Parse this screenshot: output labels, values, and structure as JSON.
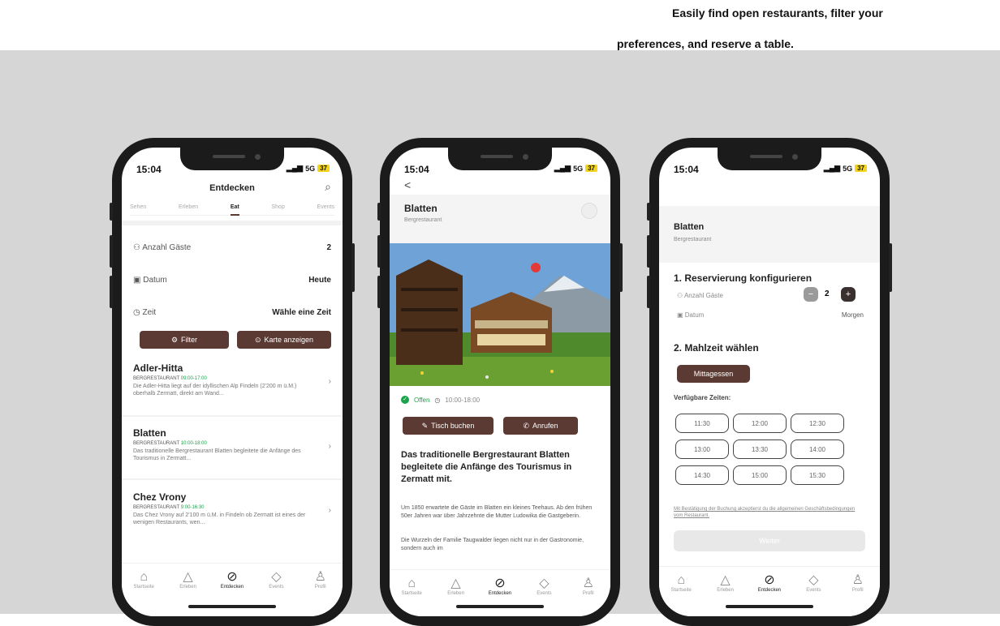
{
  "caption": {
    "line1": "Easily find open restaurants, filter your",
    "line2": "preferences, and reserve a table."
  },
  "status": {
    "time": "15:04",
    "network": "5G",
    "battery": "37"
  },
  "tab_labels": [
    "Startseite",
    "Erleben",
    "Entdecken",
    "Events",
    "Profil"
  ],
  "phone1": {
    "header_title": "Entdecken",
    "top_tabs": [
      "Sehen",
      "Erleben",
      "Eat",
      "Shop",
      "Events"
    ],
    "active_tab": "Eat",
    "guests_label": "Anzahl Gäste",
    "guests_value": "2",
    "date_label": "Datum",
    "date_value": "Heute",
    "time_label": "Zeit",
    "time_value": "Wähle eine Zeit",
    "filter_button": "Filter",
    "map_button": "Karte anzeigen",
    "restaurants": [
      {
        "name": "Adler-Hitta",
        "category": "BERGRESTAURANT",
        "hours": "09:00-17:00",
        "description": "Die Adler-Hitta liegt auf der idyllischen Alp Findeln (2'200 m ü.M.) oberhalb Zermatt, direkt am Wand..."
      },
      {
        "name": "Blatten",
        "category": "BERGRESTAURANT",
        "hours": "10:00-18:00",
        "description": "Das traditionelle Bergrestaurant Blatten begleitete die Anfänge des Tourismus in Zermatt..."
      },
      {
        "name": "Chez Vrony",
        "category": "BERGRESTAURANT",
        "hours": "9:00-16:30",
        "description": "Das Chez Vrony auf 2'100 m ü.M. in Findeln ob Zermatt ist eines der wenigen Restaurants, wen..."
      }
    ]
  },
  "phone2": {
    "back": "<",
    "title": "Blatten",
    "subtitle": "Bergrestaurant",
    "open_label": "Offen",
    "hours": "10:00-18:00",
    "book_button": "Tisch buchen",
    "call_button": "Anrufen",
    "headline": "Das traditionelle Bergrestaurant Blatten begleitete die Anfänge des Tourismus in Zermatt mit.",
    "para1": "Um 1850 erwartete die Gäste im Blatten ein kleines Teehaus. Ab den frühen 50er Jahren war über Jahrzehnte die Mutter Ludowika die Gastgeberin.",
    "para2": "Die Wurzeln der Familie Taugwalder liegen nicht nur in der Gastronomie, sondern auch im"
  },
  "phone3": {
    "title": "Blatten",
    "subtitle": "Bergrestaurant",
    "step1": "1. Reservierung konfigurieren",
    "guests_label": "Anzahl Gäste",
    "guests_value": "2",
    "minus": "−",
    "plus": "+",
    "date_label": "Datum",
    "date_value": "Morgen",
    "step2": "2. Mahlzeit wählen",
    "meal_button": "Mittagessen",
    "available_label": "Verfügbare Zeiten:",
    "slots": [
      "11:30",
      "12:00",
      "12:30",
      "13:00",
      "13:30",
      "14:00",
      "14:30",
      "15:00",
      "15:30"
    ],
    "terms": "Mit Bestätigung der Buchung akzeptierst du die allgemeinen Geschäftsbedingungen vom Restaurant.",
    "submit": "Weiter"
  }
}
